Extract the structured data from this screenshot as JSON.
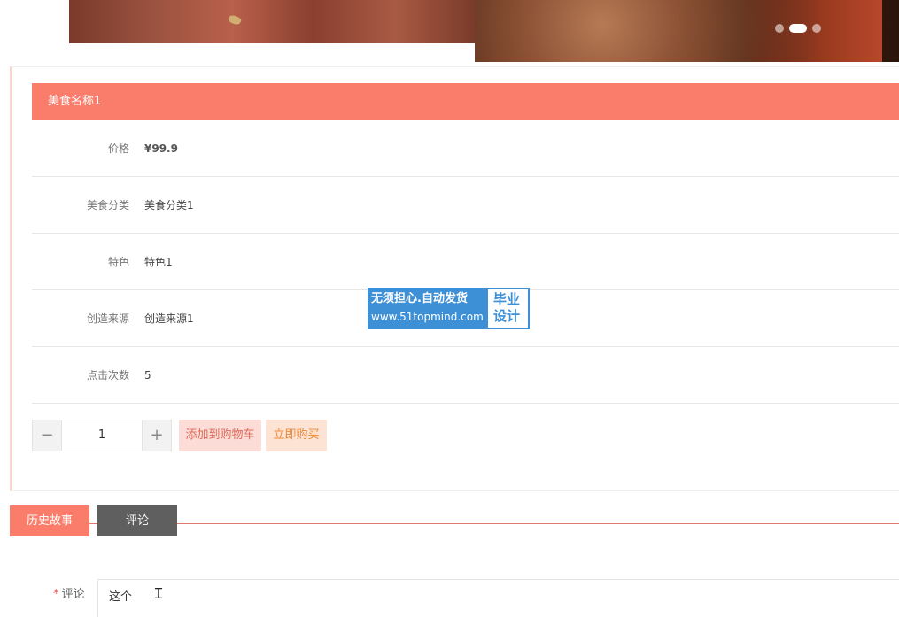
{
  "banner": {
    "dots": [
      {
        "active": false
      },
      {
        "active": true
      },
      {
        "active": false
      }
    ]
  },
  "product": {
    "name": "美食名称1",
    "fields": [
      {
        "label": "价格",
        "value": "¥99.9"
      },
      {
        "label": "美食分类",
        "value": "美食分类1"
      },
      {
        "label": "特色",
        "value": "特色1"
      },
      {
        "label": "创造来源",
        "value": "创造来源1"
      },
      {
        "label": "点击次数",
        "value": "5"
      }
    ]
  },
  "purchase": {
    "minus": "−",
    "quantity": "1",
    "plus": "+",
    "add_to_cart": "添加到购物车",
    "buy_now": "立即购买"
  },
  "watermark": {
    "line1": "无须担心.自动发货",
    "line2": "www.51topmind.com",
    "right_top": "毕业",
    "right_bottom": "设计"
  },
  "tabs": {
    "history": "历史故事",
    "comment": "评论"
  },
  "comment_form": {
    "required_mark": "*",
    "label": "评论",
    "value": "这个"
  }
}
